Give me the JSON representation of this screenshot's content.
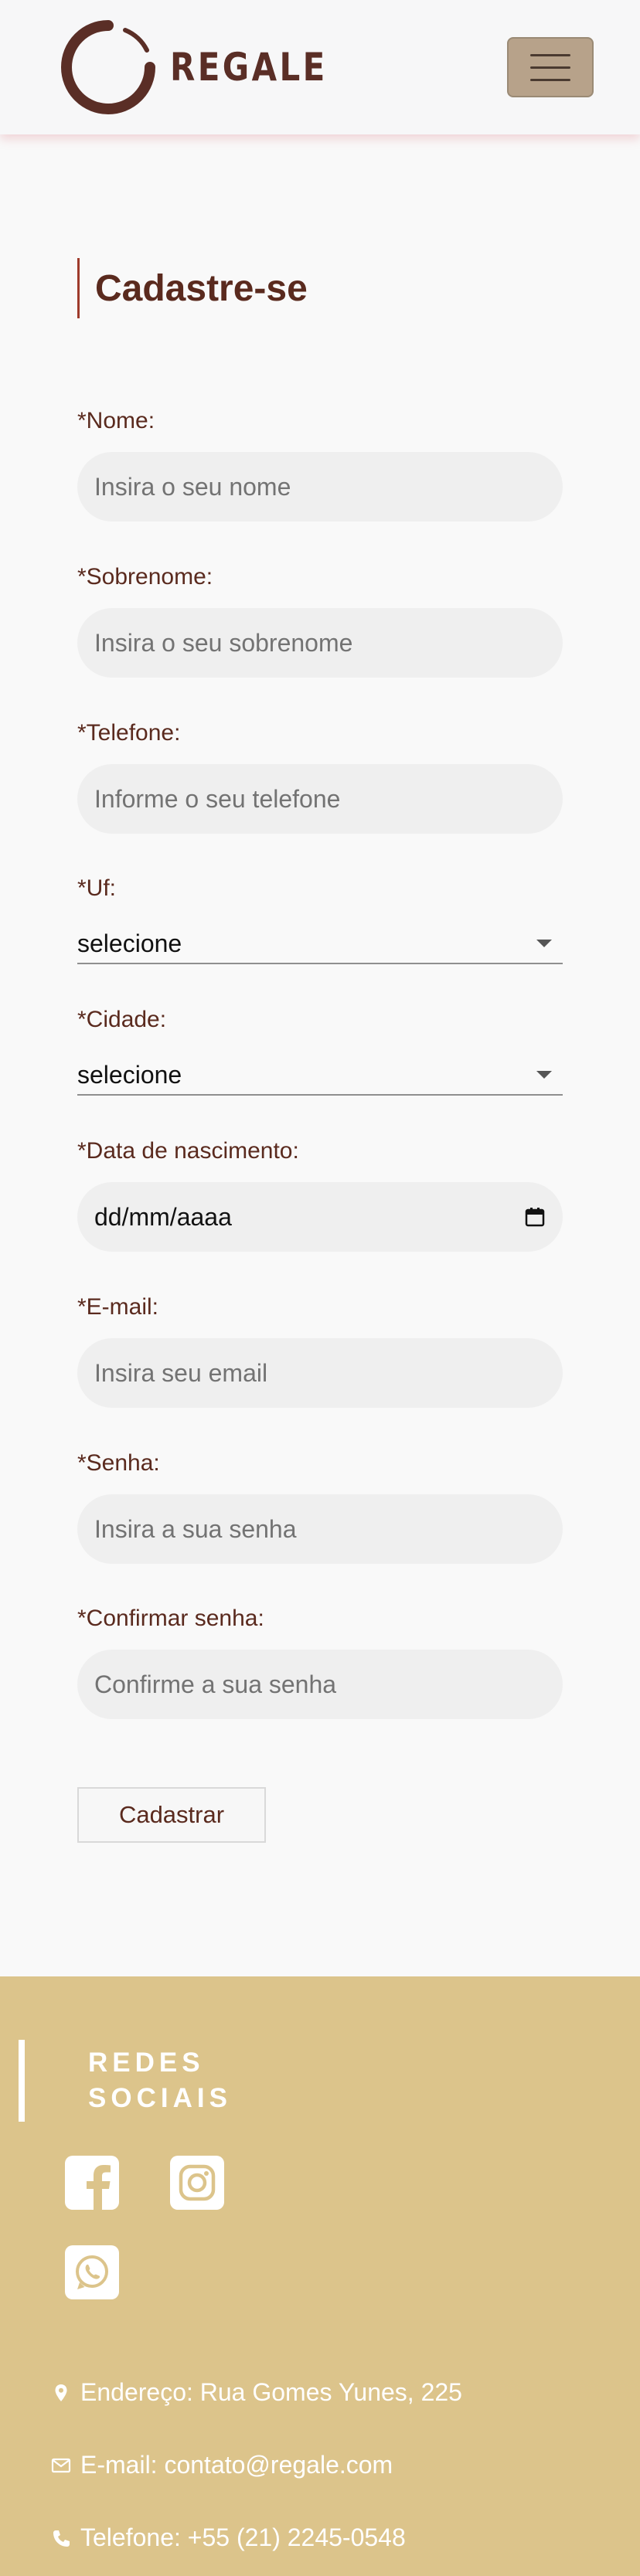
{
  "header": {
    "brand_name": "REGALE",
    "logo_icon": "regale-ring-logo",
    "menu_icon": "hamburger-menu-icon"
  },
  "form": {
    "title": "Cadastre-se",
    "nome": {
      "label": "*Nome:",
      "placeholder": "Insira o seu nome"
    },
    "sobrenome": {
      "label": "*Sobrenome:",
      "placeholder": "Insira o seu sobrenome"
    },
    "telefone": {
      "label": "*Telefone:",
      "placeholder": "Informe o seu telefone"
    },
    "uf": {
      "label": "*Uf:",
      "value": "selecione"
    },
    "cidade": {
      "label": "*Cidade:",
      "value": "selecione"
    },
    "nascimento": {
      "label": "*Data de nascimento:",
      "value": "dd/mm/aaaa"
    },
    "email": {
      "label": "*E-mail:",
      "placeholder": "Insira seu email"
    },
    "senha": {
      "label": "*Senha:",
      "placeholder": "Insira a sua senha"
    },
    "confirmar": {
      "label": "*Confirmar senha:",
      "placeholder": "Confirme a sua senha"
    },
    "submit_label": "Cadastrar"
  },
  "footer": {
    "social_title": "REDES SOCIAIS",
    "social": [
      {
        "name": "facebook-icon"
      },
      {
        "name": "instagram-icon"
      },
      {
        "name": "whatsapp-icon"
      }
    ],
    "contacts": {
      "address": "Endereço: Rua Gomes Yunes, 225",
      "email": "E-mail: contato@regale.com",
      "phone": "Telefone: +55 (21) 2245-0548"
    }
  },
  "colors": {
    "brand": "#5a2e26",
    "accent_line": "#9e3b2b",
    "menu_button": "#b7a28a",
    "footer_bg": "#dcc48b",
    "input_bg": "#efefef"
  }
}
